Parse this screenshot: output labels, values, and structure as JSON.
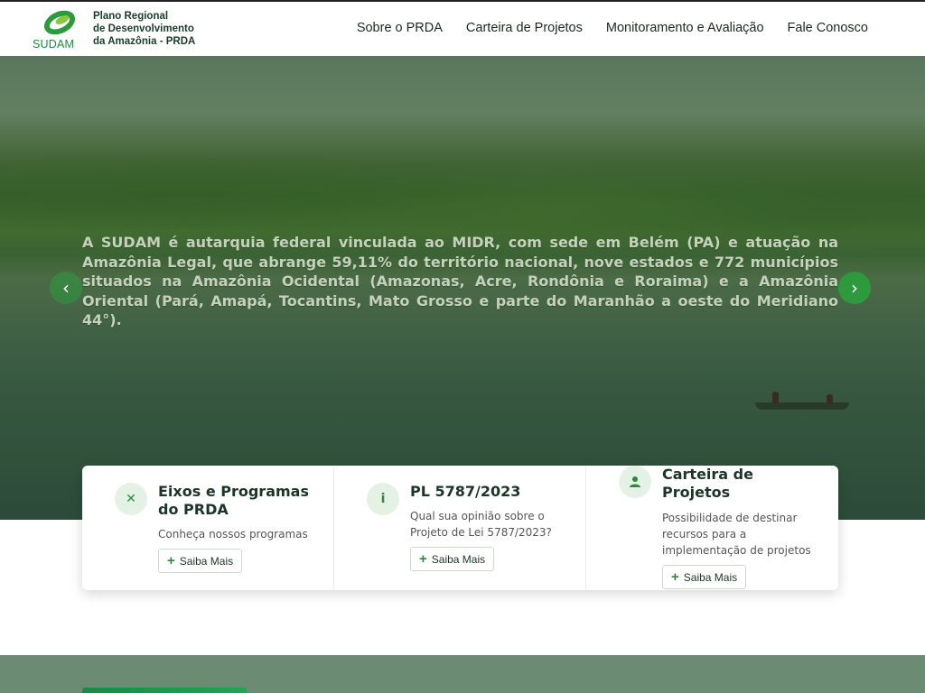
{
  "header": {
    "logo_word": "SUDAM",
    "logo_lines": [
      "Plano Regional",
      "de Desenvolvimento",
      "da Amazônia - PRDA"
    ],
    "nav": [
      "Sobre o PRDA",
      "Carteira de Projetos",
      "Monitoramento e Avaliação",
      "Fale Conosco"
    ]
  },
  "hero": {
    "text": "A SUDAM é autarquia federal vinculada ao MIDR, com sede em Belém (PA) e atuação na Amazônia Legal, que abrange 59,11% do território nacional, nove estados e 772 municípios situados na Amazônia Ocidental (Amazonas, Acre, Rondônia e Roraima) e a Amazônia Oriental (Pará, Amapá, Tocantins, Mato Grosso e parte do Maranhão a oeste do Meridiano 44°).",
    "prev_icon": "chevron-left-icon",
    "next_icon": "chevron-right-icon"
  },
  "cards": [
    {
      "icon": "close-icon",
      "title": "Eixos e Programas do PRDA",
      "desc": "Conheça nossos programas",
      "button": "Saiba Mais"
    },
    {
      "icon": "info-icon",
      "title": "PL 5787/2023",
      "desc": "Qual sua opinião sobre o Projeto de Lei 5787/2023?",
      "button": "Saiba Mais"
    },
    {
      "icon": "user-icon",
      "title": "Carteira de Projetos",
      "desc": "Possibilidade de destinar recursos para a implementação de projetos",
      "button": "Saiba Mais"
    }
  ],
  "colors": {
    "accent": "#2e9a3e",
    "text_dark": "#1c3526",
    "band": "#6c8b73"
  }
}
